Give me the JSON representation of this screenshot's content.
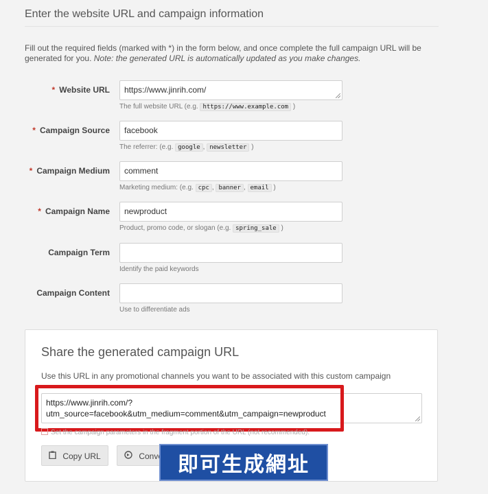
{
  "section": {
    "title": "Enter the website URL and campaign information",
    "intro_main": "Fill out the required fields (marked with *) in the form below, and once complete the full campaign URL will be generated for you.",
    "intro_note": "Note: the generated URL is automatically updated as you make changes."
  },
  "form": {
    "required_marker": "*",
    "website_url": {
      "label": "Website URL",
      "value": "https://www.jinrih.com/",
      "hint_prefix": "The full website URL (e.g.",
      "hint_code": "https://www.example.com",
      "hint_suffix": ")"
    },
    "campaign_source": {
      "label": "Campaign Source",
      "value": "facebook",
      "hint_prefix": "The referrer: (e.g.",
      "hint_code1": "google",
      "hint_code2": "newsletter",
      "hint_suffix": ")"
    },
    "campaign_medium": {
      "label": "Campaign Medium",
      "value": "comment",
      "hint_prefix": "Marketing medium: (e.g.",
      "hint_code1": "cpc",
      "hint_code2": "banner",
      "hint_code3": "email",
      "hint_suffix": ")"
    },
    "campaign_name": {
      "label": "Campaign Name",
      "value": "newproduct",
      "hint_prefix": "Product, promo code, or slogan (e.g.",
      "hint_code": "spring_sale",
      "hint_suffix": ")"
    },
    "campaign_term": {
      "label": "Campaign Term",
      "value": "",
      "hint": "Identify the paid keywords"
    },
    "campaign_content": {
      "label": "Campaign Content",
      "value": "",
      "hint": "Use to differentiate ads"
    }
  },
  "share": {
    "title": "Share the generated campaign URL",
    "description": "Use this URL in any promotional channels you want to be associated with this custom campaign",
    "url_line1": "https://www.jinrih.com/?",
    "url_line2": "utm_source=facebook&utm_medium=comment&utm_campaign=newproduct",
    "checkbox_label": "Set the campaign parameters in the fragment portion of the URL (not recommended).",
    "copy_button": "Copy URL",
    "convert_button": "Conve"
  },
  "overlay_caption": "即可生成網址",
  "colors": {
    "required": "#c0392b",
    "highlight_frame": "#d8191c",
    "overlay_bg": "#1f4fa3"
  },
  "icons": {
    "copy": "clipboard-icon",
    "convert": "link-shortener-icon"
  }
}
